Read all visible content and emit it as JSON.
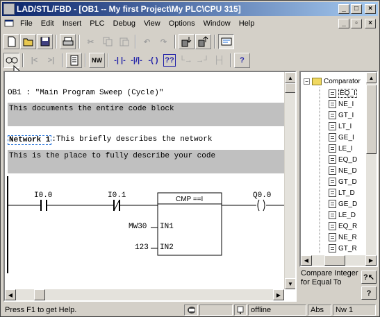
{
  "window": {
    "title": "LAD/STL/FBD  - [OB1 -- My first Project\\My PLC\\CPU 315]"
  },
  "menu": [
    "File",
    "Edit",
    "Insert",
    "PLC",
    "Debug",
    "View",
    "Options",
    "Window",
    "Help"
  ],
  "toolbar1": [
    "new-icon",
    "open-icon",
    "save-icon",
    "print-icon",
    "cut-icon",
    "copy-icon",
    "paste-icon",
    "undo-icon",
    "redo-icon",
    "download-icon",
    "upload-icon",
    "overview-icon"
  ],
  "toolbar2": [
    "monitor-icon",
    "first-network-icon",
    "next-network-icon",
    "block-icon",
    "network-insert-icon",
    "no-contact-icon",
    "nc-contact-icon",
    "coil-icon",
    "empty-box-icon",
    "open-branch-icon",
    "close-branch-icon",
    "connection-icon",
    "whats-this-icon"
  ],
  "toolbar2_labels": {
    "no_contact": "-| |-",
    "nc_contact": "-|/|-",
    "coil": "-( )",
    "empty_box": "??",
    "whats_this": "?"
  },
  "editor": {
    "ob_header": "OB1 :  \"Main Program Sweep (Cycle)\"",
    "block_comment": "This documents the entire code block",
    "network_label": "Network 1",
    "network_title": ":This briefly describes the network",
    "network_comment": "This is the place to fully describe your code",
    "ladder": {
      "contact1": "I0.0",
      "contact2": "I0.1",
      "box_title": "CMP ==I",
      "in1_operand": "MW30",
      "in1_pin": "IN1",
      "in2_operand": "123",
      "in2_pin": "IN2",
      "coil": "Q0.0"
    }
  },
  "catalog": {
    "folder": "Comparator",
    "items": [
      "EQ_I",
      "NE_I",
      "GT_I",
      "LT_I",
      "GE_I",
      "LE_I",
      "EQ_D",
      "NE_D",
      "GT_D",
      "LT_D",
      "GE_D",
      "LE_D",
      "EQ_R",
      "NE_R",
      "GT_R"
    ],
    "selected": "EQ_I",
    "hint": "Compare Integer for Equal To",
    "help_button": "?"
  },
  "statusbar": {
    "help": "Press F1 to get Help.",
    "mode": "offline",
    "abs": "Abs",
    "network": "Nw 1"
  }
}
